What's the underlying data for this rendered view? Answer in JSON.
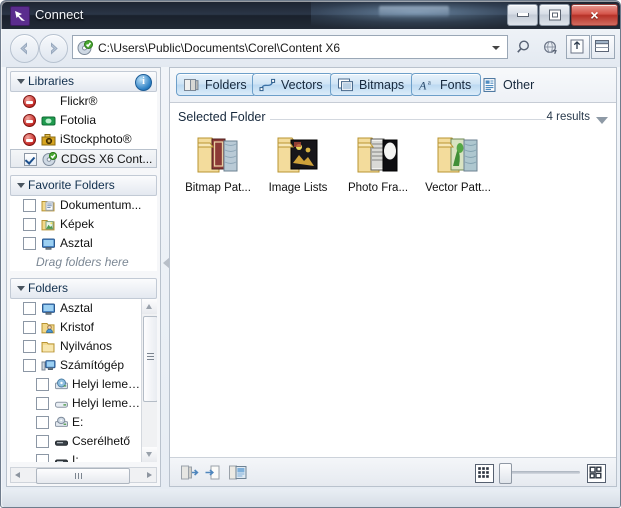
{
  "window": {
    "title": "Connect",
    "app_icon": "corel-connect-icon",
    "buttons": {
      "minimize": "minimize-button",
      "maximize": "maximize-button",
      "close": "×"
    }
  },
  "address_bar": {
    "back": "back-button",
    "forward": "forward-button",
    "path": "C:\\Users\\Public\\Documents\\Corel\\Content X6",
    "path_icon": "disc-check-icon",
    "dropdown": "path-dropdown",
    "tools": [
      {
        "name": "search-icon"
      },
      {
        "name": "refresh-globe-icon"
      },
      {
        "name": "upload-tray-icon"
      },
      {
        "name": "layout-panel-icon"
      }
    ]
  },
  "sidebar": {
    "libraries": {
      "header": "Libraries",
      "info_icon": "i",
      "items": [
        {
          "label": "Flickr®",
          "state": "blocked",
          "icon": "none",
          "selected": false
        },
        {
          "label": "Fotolia",
          "state": "blocked",
          "icon": "fotolia-icon",
          "selected": false
        },
        {
          "label": "iStockphoto®",
          "state": "blocked",
          "icon": "istockphoto-icon",
          "selected": false
        },
        {
          "label": "CDGS X6 Cont...",
          "state": "checked",
          "icon": "disc-check-icon",
          "selected": true
        }
      ]
    },
    "favorite_folders": {
      "header": "Favorite Folders",
      "items": [
        {
          "label": "Dokumentum...",
          "icon": "documents-folder-icon"
        },
        {
          "label": "Képek",
          "icon": "pictures-folder-icon"
        },
        {
          "label": "Asztal",
          "icon": "desktop-icon"
        }
      ],
      "hint": "Drag folders here"
    },
    "folders": {
      "header": "Folders",
      "items": [
        {
          "label": "Asztal",
          "icon": "desktop-icon",
          "level": 1
        },
        {
          "label": "Kristof",
          "icon": "user-folder-icon",
          "level": 1
        },
        {
          "label": "Nyilvános",
          "icon": "public-folder-icon",
          "level": 1
        },
        {
          "label": "Számítógép",
          "icon": "computer-icon",
          "level": 1
        },
        {
          "label": "Helyi leme…",
          "icon": "system-drive-icon",
          "level": 2
        },
        {
          "label": "Helyi leme…",
          "icon": "hard-drive-icon",
          "level": 2
        },
        {
          "label": "E:",
          "icon": "optical-drive-icon",
          "level": 2
        },
        {
          "label": "Cserélhető",
          "icon": "removable-drive-icon",
          "level": 2
        },
        {
          "label": "I:",
          "icon": "removable-drive-icon",
          "level": 2
        }
      ]
    }
  },
  "content": {
    "tabs": [
      {
        "label": "Folders",
        "icon": "folders-icon",
        "selected": true
      },
      {
        "label": "Vectors",
        "icon": "vectors-icon",
        "selected": true
      },
      {
        "label": "Bitmaps",
        "icon": "bitmaps-icon",
        "selected": true
      },
      {
        "label": "Fonts",
        "icon": "fonts-icon",
        "selected": true
      },
      {
        "label": "Other",
        "icon": "other-icon",
        "selected": false
      }
    ],
    "section_label": "Selected Folder",
    "results_label": "4 results",
    "items": [
      {
        "label": "Bitmap Pat...",
        "icon": "folder-bitmap-patterns"
      },
      {
        "label": "Image Lists",
        "icon": "folder-image-lists"
      },
      {
        "label": "Photo Fra...",
        "icon": "folder-photo-frames"
      },
      {
        "label": "Vector Patt...",
        "icon": "folder-vector-patterns"
      }
    ]
  },
  "statusbar": {
    "left_icons": [
      {
        "name": "import-icon"
      },
      {
        "name": "export-icon"
      },
      {
        "name": "tray-icon"
      }
    ],
    "zoom_small_icon": "small-thumbnails-icon",
    "zoom_large_icon": "large-thumbnails-icon"
  },
  "colors": {
    "titlebar": "#222a36",
    "accent": "#5b2d8e",
    "tab_selected": "#cfe4f5",
    "close_button": "#c9453b"
  }
}
